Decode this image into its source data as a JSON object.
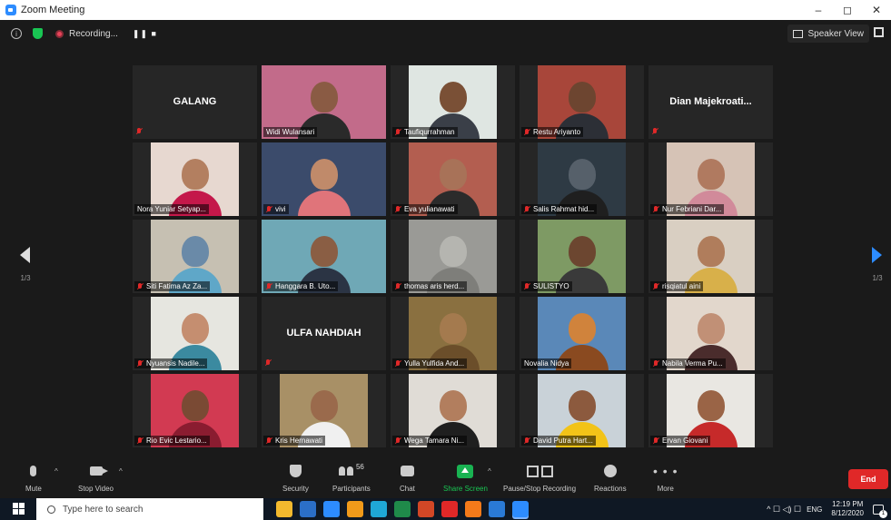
{
  "window": {
    "title": "Zoom Meeting",
    "controls": [
      "–",
      "◻",
      "✕"
    ]
  },
  "topbar": {
    "recording_label": "Recording...",
    "recording_controls": "❚❚ ■",
    "speaker_view_label": "Speaker View"
  },
  "tiles": [
    {
      "name": "GALANG",
      "mode": "name",
      "muted": true
    },
    {
      "name": "Widi Wulansari",
      "mode": "video",
      "muted": false,
      "active": true,
      "bg": "#c26b8a",
      "skin": "#8a5b44",
      "cloth": "#2a2a2a"
    },
    {
      "name": "Taufiqurrahman",
      "mode": "video",
      "muted": true,
      "bg": "#dfe6e2",
      "skin": "#7a5036",
      "cloth": "#3a3f48"
    },
    {
      "name": "Restu Ariyanto",
      "mode": "video",
      "muted": true,
      "bg": "#a8463a",
      "skin": "#6d4530",
      "cloth": "#2c2f36"
    },
    {
      "name": "Dian  Majekroati...",
      "mode": "name",
      "muted": true
    },
    {
      "name": "Nora Yuniar Setyap...",
      "mode": "video",
      "muted": false,
      "bg": "#e7d8d0",
      "skin": "#b37f60",
      "cloth": "#c4184a"
    },
    {
      "name": "vivi",
      "mode": "video",
      "muted": true,
      "bg": "#3b4b6b",
      "skin": "#c08a6a",
      "cloth": "#e0747a"
    },
    {
      "name": "Eva yulianawati",
      "mode": "video",
      "muted": true,
      "bg": "#b35e50",
      "skin": "#a87258",
      "cloth": "#2b2b2b"
    },
    {
      "name": "Salis Rahmat hid...",
      "mode": "video",
      "muted": true,
      "bg": "#2e3a44",
      "skin": "#56606a",
      "cloth": "#1f1f1f"
    },
    {
      "name": "Nur Febriani Dar...",
      "mode": "video",
      "muted": true,
      "bg": "#d6c3b6",
      "skin": "#b07a60",
      "cloth": "#d18a9a"
    },
    {
      "name": "Siti Fatima Az Za...",
      "mode": "video",
      "muted": true,
      "bg": "#c6c0b2",
      "skin": "#6a8aa8",
      "cloth": "#5fa7c8"
    },
    {
      "name": "Hanggara B. Uto...",
      "mode": "video",
      "muted": true,
      "bg": "#6fa8b6",
      "skin": "#8a5e44",
      "cloth": "#2b3444"
    },
    {
      "name": "thomas aris herd...",
      "mode": "video",
      "muted": true,
      "bg": "#9a9a96",
      "skin": "#b5b5b0",
      "cloth": "#7e7e7a"
    },
    {
      "name": "SULISTYO",
      "mode": "video",
      "muted": true,
      "bg": "#7e9a64",
      "skin": "#6c4630",
      "cloth": "#3a3a3a"
    },
    {
      "name": "risqiatul aini",
      "mode": "video",
      "muted": true,
      "bg": "#d9cfc2",
      "skin": "#b07d5c",
      "cloth": "#d8b04a"
    },
    {
      "name": "Nyuansis Nadile...",
      "mode": "video",
      "muted": true,
      "bg": "#e6e6e0",
      "skin": "#c58e70",
      "cloth": "#3b8aa0"
    },
    {
      "name": "ULFA NAHDIAH",
      "mode": "name",
      "muted": true
    },
    {
      "name": "Yulla Yulfida And...",
      "mode": "video",
      "muted": true,
      "bg": "#8a7040",
      "skin": "#a47a4e",
      "cloth": "#6b4e2a"
    },
    {
      "name": "Novalia Nidya",
      "mode": "video",
      "muted": false,
      "bg": "#5a88b8",
      "skin": "#d0833c",
      "cloth": "#8a4a20"
    },
    {
      "name": "Nabila Verma Pu...",
      "mode": "video",
      "muted": true,
      "bg": "#e2d7cc",
      "skin": "#c19076",
      "cloth": "#4a2c2c"
    },
    {
      "name": "Rio Evic Lestario...",
      "mode": "video",
      "muted": true,
      "bg": "#d23a52",
      "skin": "#7a4a34",
      "cloth": "#8a1c30"
    },
    {
      "name": "Kris Hernawati",
      "mode": "video",
      "muted": true,
      "bg": "#a89066",
      "skin": "#9a6a4c",
      "cloth": "#f0f0f0"
    },
    {
      "name": "Wega Tamara Ni...",
      "mode": "video",
      "muted": true,
      "bg": "#e0dcd6",
      "skin": "#b27e5e",
      "cloth": "#1f1f1f"
    },
    {
      "name": "David Putra Hart...",
      "mode": "video",
      "muted": true,
      "bg": "#c9d2d8",
      "skin": "#8c5a3e",
      "cloth": "#f2c318"
    },
    {
      "name": "Ervan Giovani",
      "mode": "video",
      "muted": true,
      "bg": "#e9e7e2",
      "skin": "#9a6446",
      "cloth": "#c62a2a"
    }
  ],
  "paging": {
    "prev_label": "1/3",
    "next_label": "1/3"
  },
  "toolbar": {
    "mute": "Mute",
    "stop_video": "Stop Video",
    "security": "Security",
    "participants": "Participants",
    "participants_count": "56",
    "chat": "Chat",
    "share_screen": "Share Screen",
    "pause_stop_recording": "Pause/Stop Recording",
    "reactions": "Reactions",
    "more": "More",
    "more_glyph": "• • •",
    "end": "End",
    "caret": "^"
  },
  "taskbar": {
    "search_placeholder": "Type here to search",
    "apps": [
      "#f2b92e",
      "#2b6fc8",
      "#2d8cff",
      "#f09a1a",
      "#1fa7d6",
      "#1f8a4a",
      "#d24726",
      "#e02828",
      "#f47a1a",
      "#2a7ad6",
      "#2d8cff"
    ],
    "system_icons": "^ ☐ ◁) ☐",
    "language": "ENG",
    "time": "12:19 PM",
    "date": "8/12/2020",
    "notification_count": "1"
  }
}
